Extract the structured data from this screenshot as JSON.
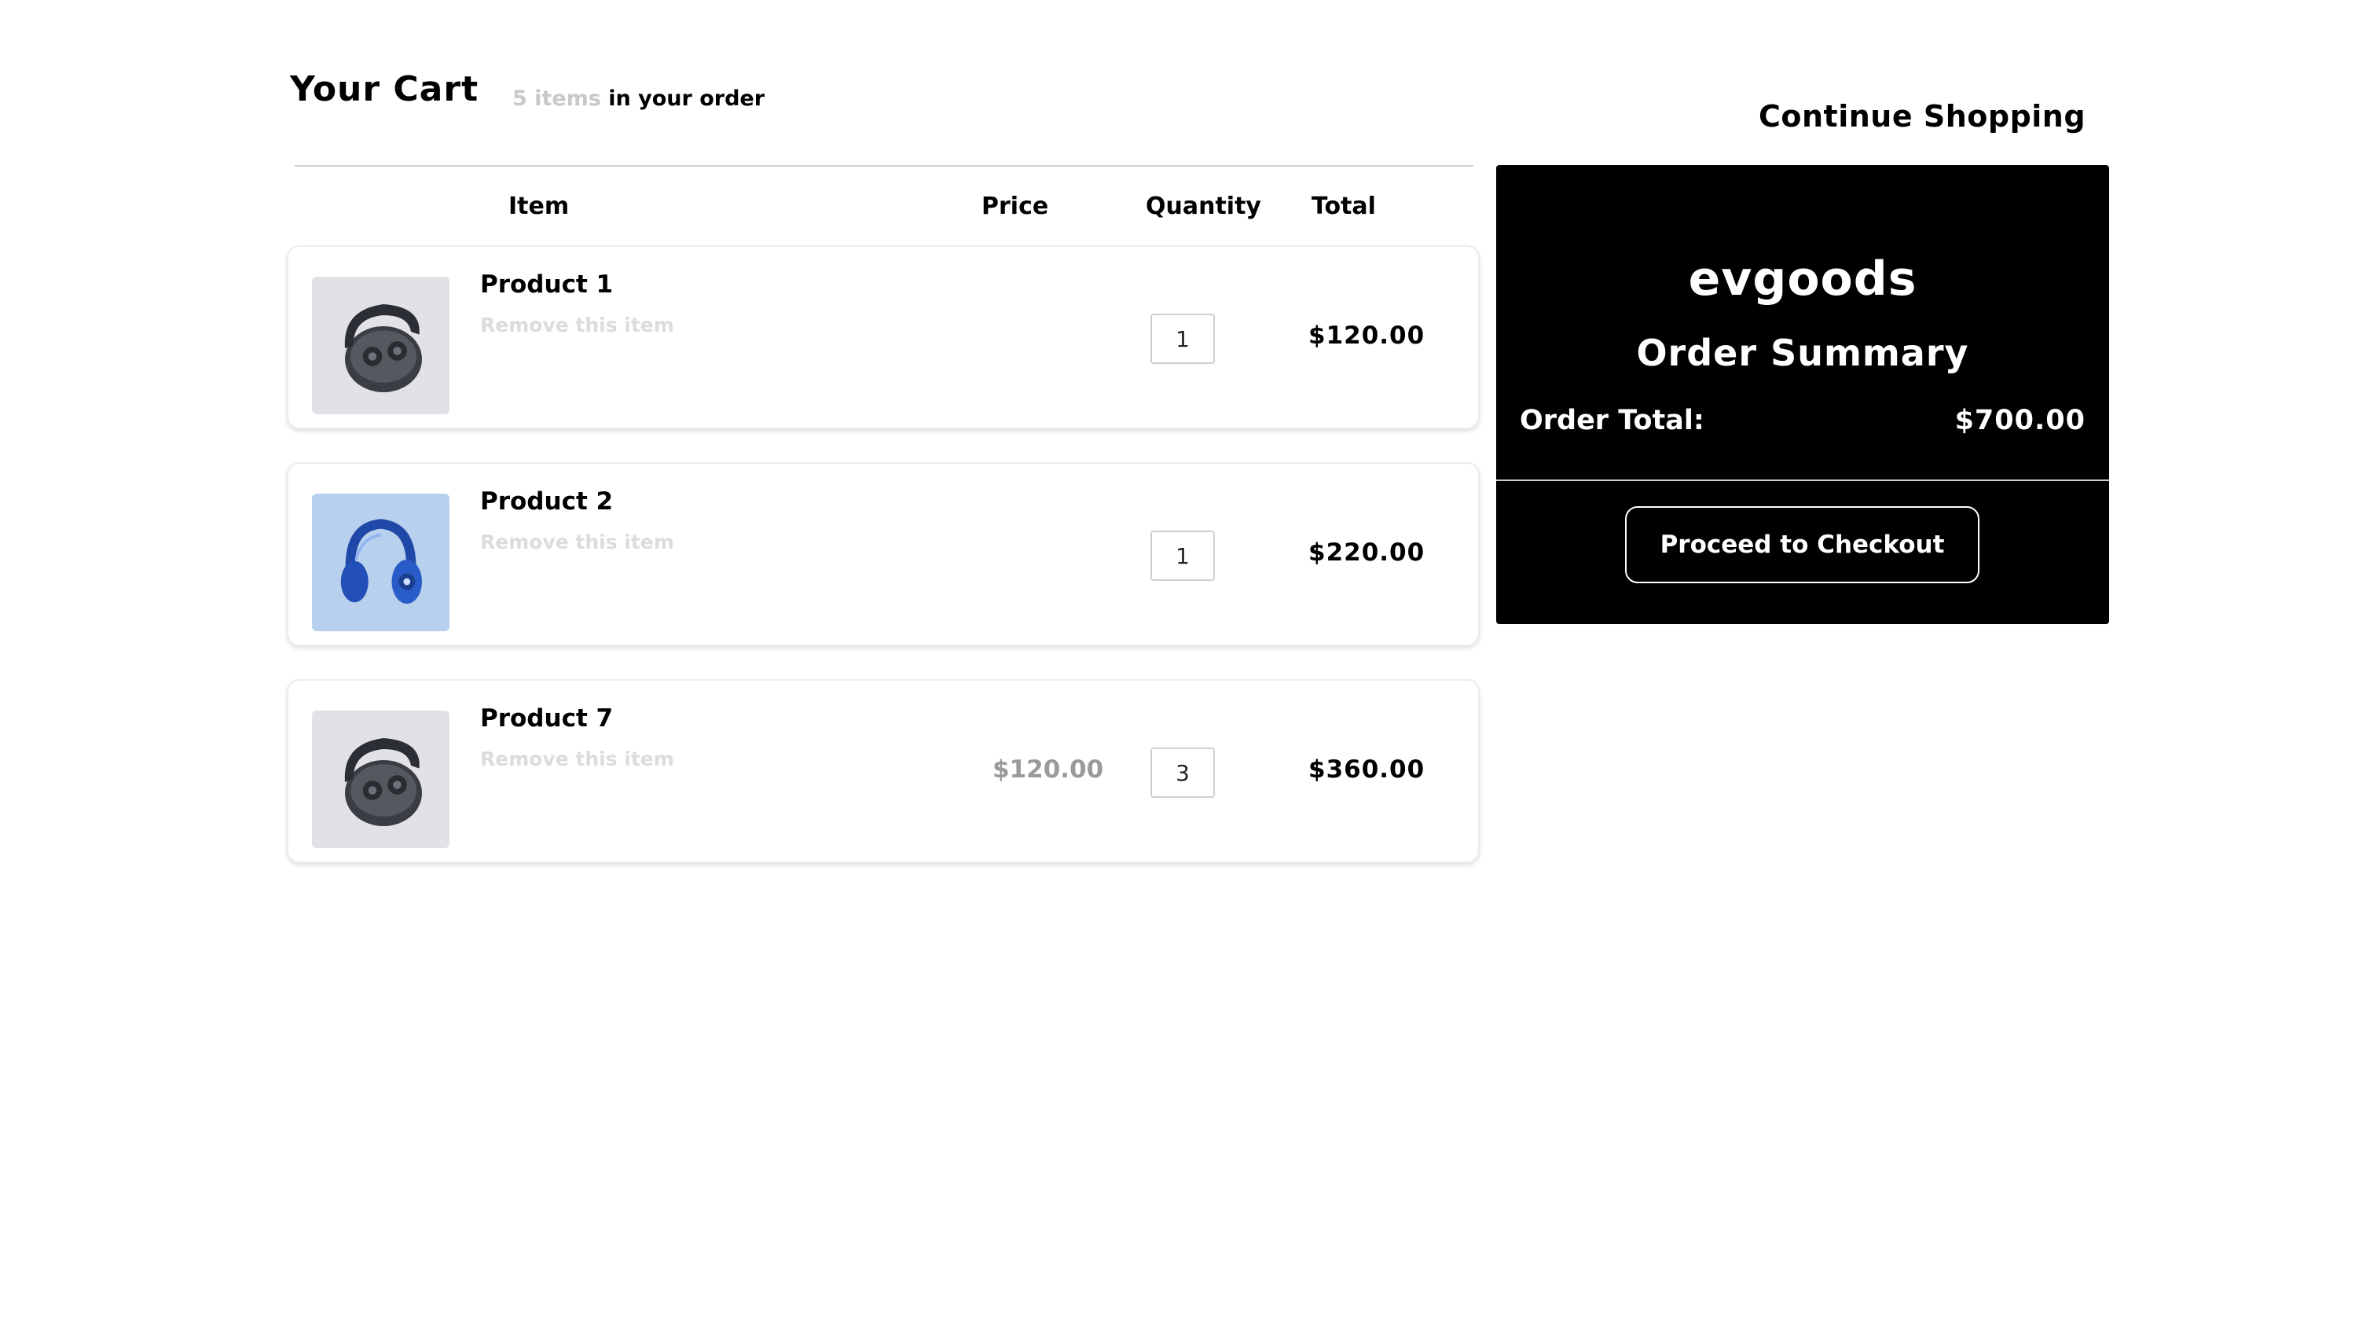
{
  "header": {
    "title": "Your Cart",
    "count_muted": "5 items",
    "count_rest": " in your order",
    "continue_label": "Continue Shopping"
  },
  "columns": {
    "item": "Item",
    "price": "Price",
    "quantity": "Quantity",
    "total": "Total"
  },
  "items": [
    {
      "name": "Product 1",
      "remove_label": "Remove this item",
      "price": "",
      "quantity": "1",
      "total": "$120.00",
      "image": "earbuds-case",
      "image_bg": "#e2e2e6"
    },
    {
      "name": "Product 2",
      "remove_label": "Remove this item",
      "price": "",
      "quantity": "1",
      "total": "$220.00",
      "image": "headphones",
      "image_bg": "#b6d0ee"
    },
    {
      "name": "Product 7",
      "remove_label": "Remove this item",
      "price": "$120.00",
      "quantity": "3",
      "total": "$360.00",
      "image": "earbuds-case",
      "image_bg": "#e2e2e6"
    }
  ],
  "summary": {
    "brand": "evgoods",
    "title": "Order Summary",
    "total_label": "Order Total:",
    "total_value": "$700.00",
    "checkout_label": "Proceed to Checkout"
  },
  "colors": {
    "panel_bg": "#000000",
    "muted_text": "#c8c8c8",
    "remove_text": "#dcdcdc",
    "price_text": "#9a9a9a"
  }
}
